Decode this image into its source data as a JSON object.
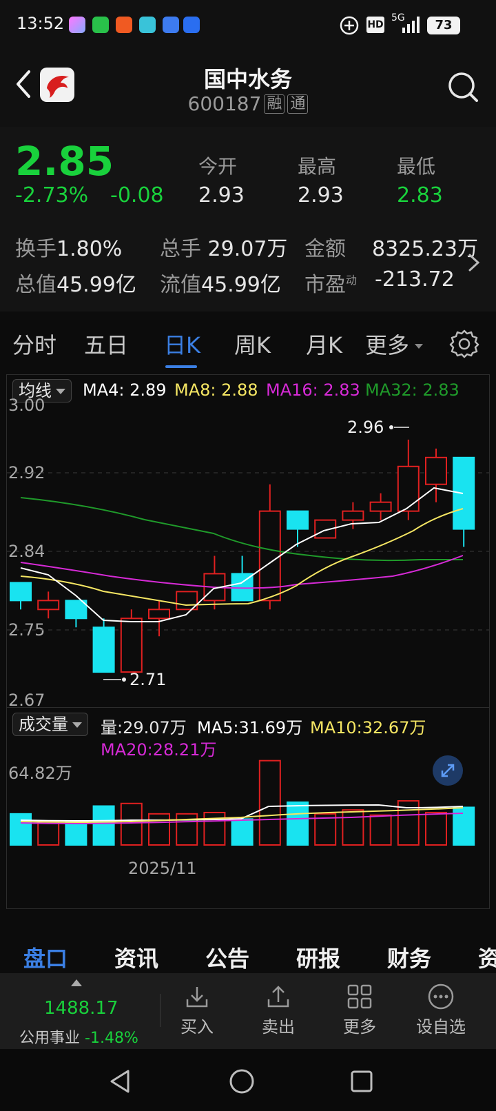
{
  "status_bar": {
    "time": "13:52",
    "network": "5G",
    "hd": "HD",
    "battery": "73"
  },
  "header": {
    "title": "国中水务",
    "code": "600187",
    "tag1": "融",
    "tag2": "通"
  },
  "quote": {
    "price": "2.85",
    "change_pct": "-2.73%",
    "change": "-0.08",
    "open_label": "今开",
    "open": "2.93",
    "high_label": "最高",
    "high": "2.93",
    "low_label": "最低",
    "low": "2.83",
    "turnover_label": "换手",
    "turnover": "1.80%",
    "total_hands_label": "总手",
    "total_hands": "29.07万",
    "amount_label": "金额",
    "amount": "8325.23万",
    "mktcap_label": "总值",
    "mktcap": "45.99亿",
    "float_label": "流值",
    "float_cap": "45.99亿",
    "pe_label": "市盈",
    "pe_sup": "动",
    "pe": "-213.72"
  },
  "tabs": [
    "分时",
    "五日",
    "日K",
    "周K",
    "月K",
    "更多"
  ],
  "active_tab": "日K",
  "chart": {
    "ma_selector": "均线",
    "ma4": "MA4: 2.89",
    "ma8": "MA8: 2.88",
    "ma16": "MA16: 2.83",
    "ma32": "MA32: 2.83",
    "y_labels": [
      "3.00",
      "2.92",
      "2.84",
      "2.75",
      "2.67"
    ],
    "high_marker": "2.96",
    "low_marker": "2.71",
    "vol_selector": "成交量",
    "vol_label": "量:29.07万",
    "vol_ma5": "MA5:31.69万",
    "vol_ma10": "MA10:32.67万",
    "vol_ma20": "MA20:28.21万",
    "vol_max": "64.82万",
    "date_label": "2025/11"
  },
  "colors": {
    "up": "#e02020",
    "down": "#19e3f0",
    "ma4": "#ffffff",
    "ma8": "#f5e663",
    "ma16": "#d62ad6",
    "ma32": "#1f9a2a",
    "green_text": "#19d13c",
    "accent": "#3b7fe3"
  },
  "chart_data": {
    "type": "candlestick",
    "ylim": [
      2.67,
      3.0
    ],
    "candles": [
      {
        "open": 2.8,
        "close": 2.78,
        "high": 2.8,
        "low": 2.77
      },
      {
        "open": 2.77,
        "close": 2.78,
        "high": 2.79,
        "low": 2.76
      },
      {
        "open": 2.78,
        "close": 2.76,
        "high": 2.78,
        "low": 2.75
      },
      {
        "open": 2.75,
        "close": 2.7,
        "high": 2.76,
        "low": 2.7
      },
      {
        "open": 2.7,
        "close": 2.76,
        "high": 2.77,
        "low": 2.7
      },
      {
        "open": 2.76,
        "close": 2.77,
        "high": 2.78,
        "low": 2.74
      },
      {
        "open": 2.77,
        "close": 2.79,
        "high": 2.79,
        "low": 2.77
      },
      {
        "open": 2.78,
        "close": 2.81,
        "high": 2.83,
        "low": 2.77
      },
      {
        "open": 2.81,
        "close": 2.78,
        "high": 2.83,
        "low": 2.78
      },
      {
        "open": 2.78,
        "close": 2.88,
        "high": 2.91,
        "low": 2.77
      },
      {
        "open": 2.88,
        "close": 2.86,
        "high": 2.88,
        "low": 2.84
      },
      {
        "open": 2.85,
        "close": 2.87,
        "high": 2.87,
        "low": 2.85
      },
      {
        "open": 2.87,
        "close": 2.88,
        "high": 2.89,
        "low": 2.86
      },
      {
        "open": 2.88,
        "close": 2.89,
        "high": 2.9,
        "low": 2.87
      },
      {
        "open": 2.88,
        "close": 2.93,
        "high": 2.96,
        "low": 2.87
      },
      {
        "open": 2.91,
        "close": 2.94,
        "high": 2.95,
        "low": 2.89
      },
      {
        "open": 2.94,
        "close": 2.86,
        "high": 2.94,
        "low": 2.84
      }
    ],
    "volume_max": 64.82,
    "volumes": [
      24,
      18,
      18,
      30,
      32,
      24,
      24,
      25,
      20,
      65,
      33,
      24,
      27,
      23,
      34,
      25,
      29
    ],
    "volume_ma5": [
      23,
      22,
      22,
      23,
      24,
      24,
      25,
      26,
      25,
      33,
      34,
      34,
      35,
      35,
      32,
      32,
      31.69
    ],
    "volume_ma10": [
      23,
      22,
      22,
      23,
      25,
      25,
      24,
      25,
      24,
      28,
      29,
      29,
      29,
      30,
      31,
      32,
      32.67
    ]
  },
  "bottom_tabs": [
    "盘口",
    "资讯",
    "公告",
    "研报",
    "财务",
    "资"
  ],
  "action_bar": {
    "index_value": "1488.17",
    "index_name": "公用事业",
    "index_change": "-1.48%",
    "buy": "买入",
    "sell": "卖出",
    "more": "更多",
    "watch": "设自选"
  }
}
